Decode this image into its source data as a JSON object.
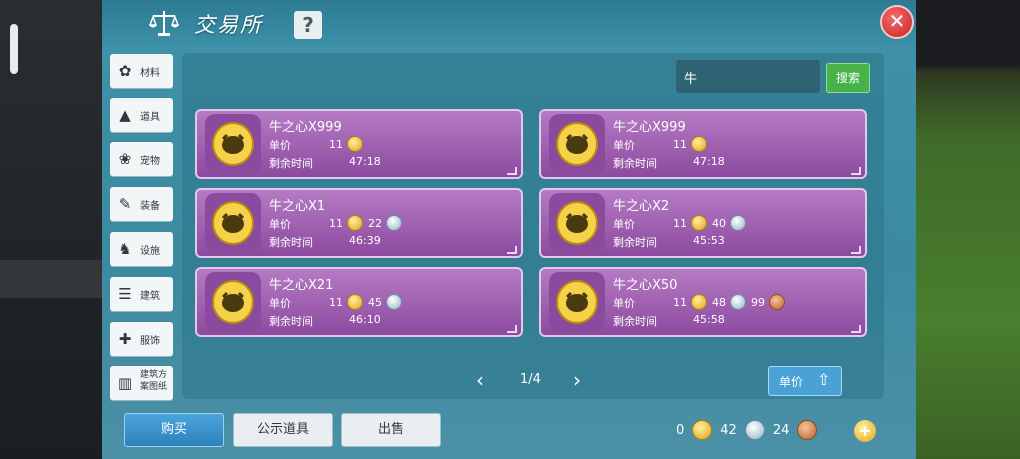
{
  "header": {
    "title": "交易所",
    "help_label": "?",
    "close_label": "✕"
  },
  "sidebar": {
    "items": [
      {
        "label": "材料",
        "icon": "materials-icon"
      },
      {
        "label": "道具",
        "icon": "props-icon"
      },
      {
        "label": "宠物",
        "icon": "pet-paw-icon"
      },
      {
        "label": "装备",
        "icon": "equipment-icon"
      },
      {
        "label": "设施",
        "icon": "facility-icon"
      },
      {
        "label": "建筑",
        "icon": "building-icon"
      },
      {
        "label": "服饰",
        "icon": "clothing-icon"
      },
      {
        "label": "建筑方案图纸",
        "icon": "blueprint-icon"
      }
    ]
  },
  "search": {
    "value": "牛",
    "button_label": "搜索"
  },
  "listing": {
    "price_label": "单价",
    "time_label": "剩余时间",
    "items": [
      {
        "name": "牛之心X999",
        "gold": "11",
        "silver": "",
        "copper": "",
        "time": "47:18"
      },
      {
        "name": "牛之心X999",
        "gold": "11",
        "silver": "",
        "copper": "",
        "time": "47:18"
      },
      {
        "name": "牛之心X1",
        "gold": "11",
        "silver": "22",
        "copper": "",
        "time": "46:39"
      },
      {
        "name": "牛之心X2",
        "gold": "11",
        "silver": "40",
        "copper": "",
        "time": "45:53"
      },
      {
        "name": "牛之心X21",
        "gold": "11",
        "silver": "45",
        "copper": "",
        "time": "46:10"
      },
      {
        "name": "牛之心X50",
        "gold": "11",
        "silver": "48",
        "copper": "99",
        "time": "45:58"
      }
    ]
  },
  "pagination": {
    "text": "1/4",
    "prev": "‹",
    "next": "›"
  },
  "sort": {
    "label": "单价",
    "icon": "sort-up-icon"
  },
  "bottom": {
    "buy": "购买",
    "public": "公示道具",
    "sell": "出售"
  },
  "wallet": {
    "gold": "0",
    "silver": "42",
    "copper": "24"
  },
  "colors": {
    "panel": "#3f93aa",
    "card": "#a060b5",
    "accent_button": "#4aa1d6",
    "search_button": "#47b24a"
  }
}
